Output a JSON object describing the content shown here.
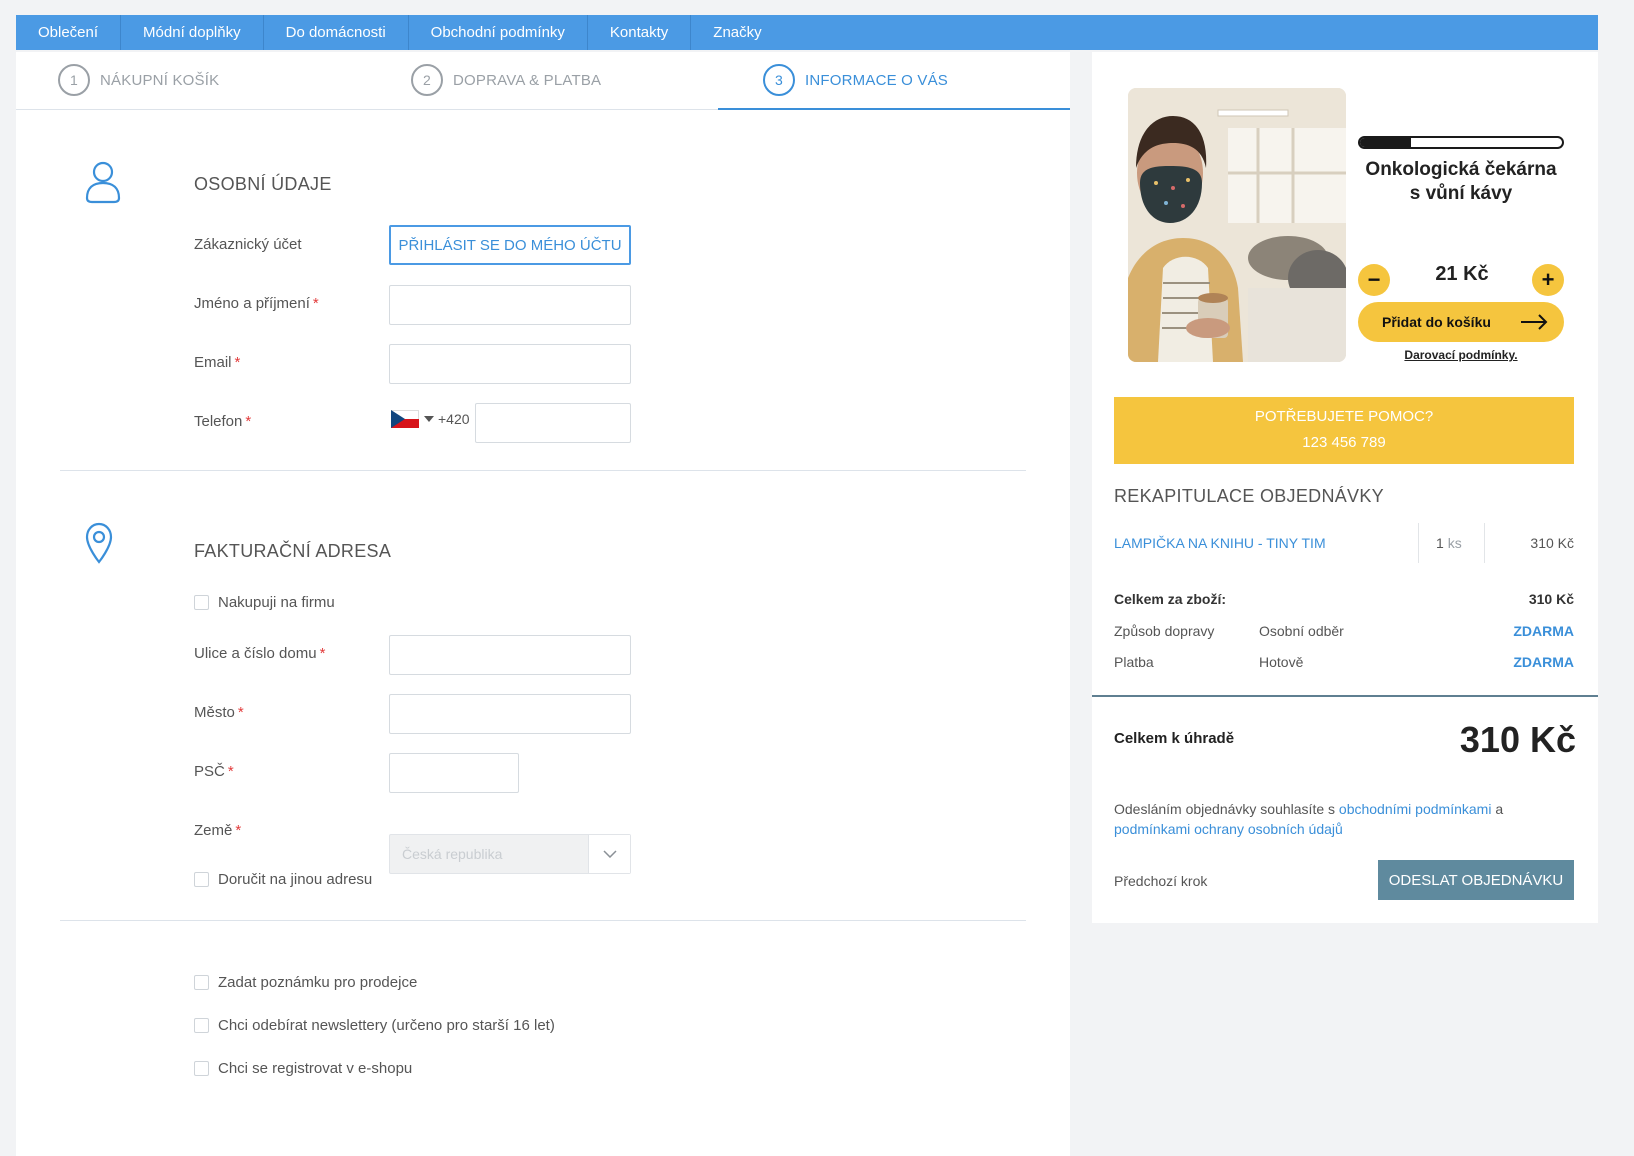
{
  "nav": [
    "Oblečení",
    "Módní doplňky",
    "Do domácnosti",
    "Obchodní podmínky",
    "Kontakty",
    "Značky"
  ],
  "steps": [
    {
      "num": "1",
      "label": "NÁKUPNÍ KOŠÍK"
    },
    {
      "num": "2",
      "label": "DOPRAVA & PLATBA"
    },
    {
      "num": "3",
      "label": "INFORMACE O VÁS"
    }
  ],
  "personal": {
    "title": "OSOBNÍ ÚDAJE",
    "account_label": "Zákaznický účet",
    "login_button": "PŘIHLÁSIT SE DO MÉHO ÚČTU",
    "name_label": "Jméno a příjmení",
    "email_label": "Email",
    "phone_label": "Telefon",
    "phone_prefix": "+420",
    "required_mark": "*"
  },
  "billing": {
    "title": "FAKTURAČNÍ ADRESA",
    "company_check": "Nakupuji na firmu",
    "street_label": "Ulice a číslo domu",
    "city_label": "Město",
    "zip_label": "PSČ",
    "country_label": "Země",
    "country_value": "Česká republika",
    "other_address_check": "Doručit na jinou adresu"
  },
  "extras": {
    "note_check": "Zadat poznámku pro prodejce",
    "newsletter_check": "Chci odebírat newslettery (určeno pro starší 16 let)",
    "register_check": "Chci se registrovat v e-shopu"
  },
  "promo": {
    "title_line1": "Onkologická čekárna",
    "title_line2": "s vůní kávy",
    "progress_fraction": 0.25,
    "minus": "−",
    "plus": "+",
    "price": "21 Kč",
    "add_button": "Přidat do košíku",
    "terms_link": "Darovací podmínky."
  },
  "help": {
    "line1": "POTŘEBUJETE POMOC?",
    "line2": "123 456 789"
  },
  "recap": {
    "title": "REKAPITULACE OBJEDNÁVKY",
    "item": {
      "name": "LAMPIČKA NA KNIHU - TINY TIM",
      "qty": "1",
      "unit": "ks",
      "price": "310 Kč"
    },
    "goods_total_label": "Celkem za zboží:",
    "goods_total_value": "310 Kč",
    "shipping_label": "Způsob dopravy",
    "shipping_method": "Osobní odběr",
    "shipping_price": "ZDARMA",
    "payment_label": "Platba",
    "payment_method": "Hotově",
    "payment_price": "ZDARMA",
    "total_label": "Celkem k úhradě",
    "total_value": "310 Kč",
    "consent_pre": "Odesláním objednávky souhlasíte s ",
    "consent_link1": "obchodními podmínkami",
    "consent_mid": " a ",
    "consent_link2": "podmínkami ochrany osobních údajů",
    "prev_step": "Předchozí krok",
    "submit": "ODESLAT OBJEDNÁVKU"
  },
  "colors": {
    "accent": "#4b9ae4",
    "yellow": "#f5c53e",
    "submit": "#5f8a9e"
  }
}
